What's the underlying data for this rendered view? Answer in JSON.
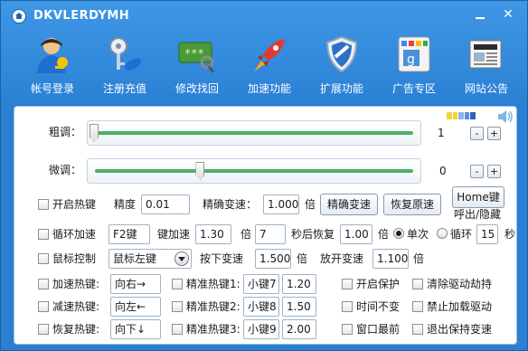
{
  "window": {
    "title": "DKVLERDYMH",
    "minimize_label": "",
    "close_label": "✕"
  },
  "toolbar": [
    {
      "label": "帐号登录",
      "icon": "user-key-icon"
    },
    {
      "label": "注册充值",
      "icon": "keys-icon"
    },
    {
      "label": "修改找回",
      "icon": "password-search-icon"
    },
    {
      "label": "加速功能",
      "icon": "rocket-icon"
    },
    {
      "label": "扩展功能",
      "icon": "shield-icon"
    },
    {
      "label": "广告专区",
      "icon": "google-ad-icon"
    },
    {
      "label": "网站公告",
      "icon": "news-icon"
    }
  ],
  "coarse": {
    "label": "粗调：",
    "value": "1",
    "level": 0.0,
    "minus": "-",
    "plus": "+"
  },
  "fine": {
    "label": "微调：",
    "value": "0",
    "level": 0.33,
    "minus": "-",
    "plus": "+"
  },
  "row1": {
    "enable_hotkey": "开启热键",
    "precision_label": "精度",
    "precision_value": "0.01",
    "exact_speed_label": "精确变速：",
    "exact_speed_value": "1.000",
    "times": "倍",
    "exact_speed_button": "精确变速",
    "restore_speed_button": "恢复原速",
    "home_key_button": "Home键",
    "call_hide_label": "呼出/隐藏"
  },
  "row2": {
    "loop_speed": "循环加速",
    "loop_key": "F2键",
    "key_speed_label": "键加速",
    "key_speed_value": "1.30",
    "times1": "倍",
    "seconds_value": "7",
    "restore_after": "秒后恢复",
    "restore_value": "1.00",
    "times2": "倍",
    "single_label": "单次",
    "loop_label": "循环",
    "loop_seconds": "15",
    "seconds_unit": "秒"
  },
  "row3": {
    "mouse_control": "鼠标控制",
    "mouse_key": "鼠标左键",
    "press_speed_label": "按下变速",
    "press_speed_value": "1.500",
    "times1": "倍",
    "release_speed_label": "放开变速",
    "release_speed_value": "1.100",
    "times2": "倍"
  },
  "hotkeys": [
    {
      "label": "加速热键:",
      "key": "向右→",
      "exact_label": "精准热键1:",
      "exact_key": "小键7",
      "exact_value": "1.20",
      "extra_a": "开启保护",
      "extra_b": "清除驱动劫持"
    },
    {
      "label": "减速热键:",
      "key": "向左←",
      "exact_label": "精准热键2:",
      "exact_key": "小键8",
      "exact_value": "1.50",
      "extra_a": "时间不变",
      "extra_b": "禁止加载驱动"
    },
    {
      "label": "恢复热键:",
      "key": "向下↓",
      "exact_label": "精准热键3:",
      "exact_key": "小键9",
      "exact_value": "2.00",
      "extra_a": "窗口最前",
      "extra_b": "退出保持变速"
    }
  ],
  "colors": {
    "titlebar": "#2e7fd0",
    "slider_track": "#4caf6a",
    "panel_bg": "#ffffff"
  }
}
